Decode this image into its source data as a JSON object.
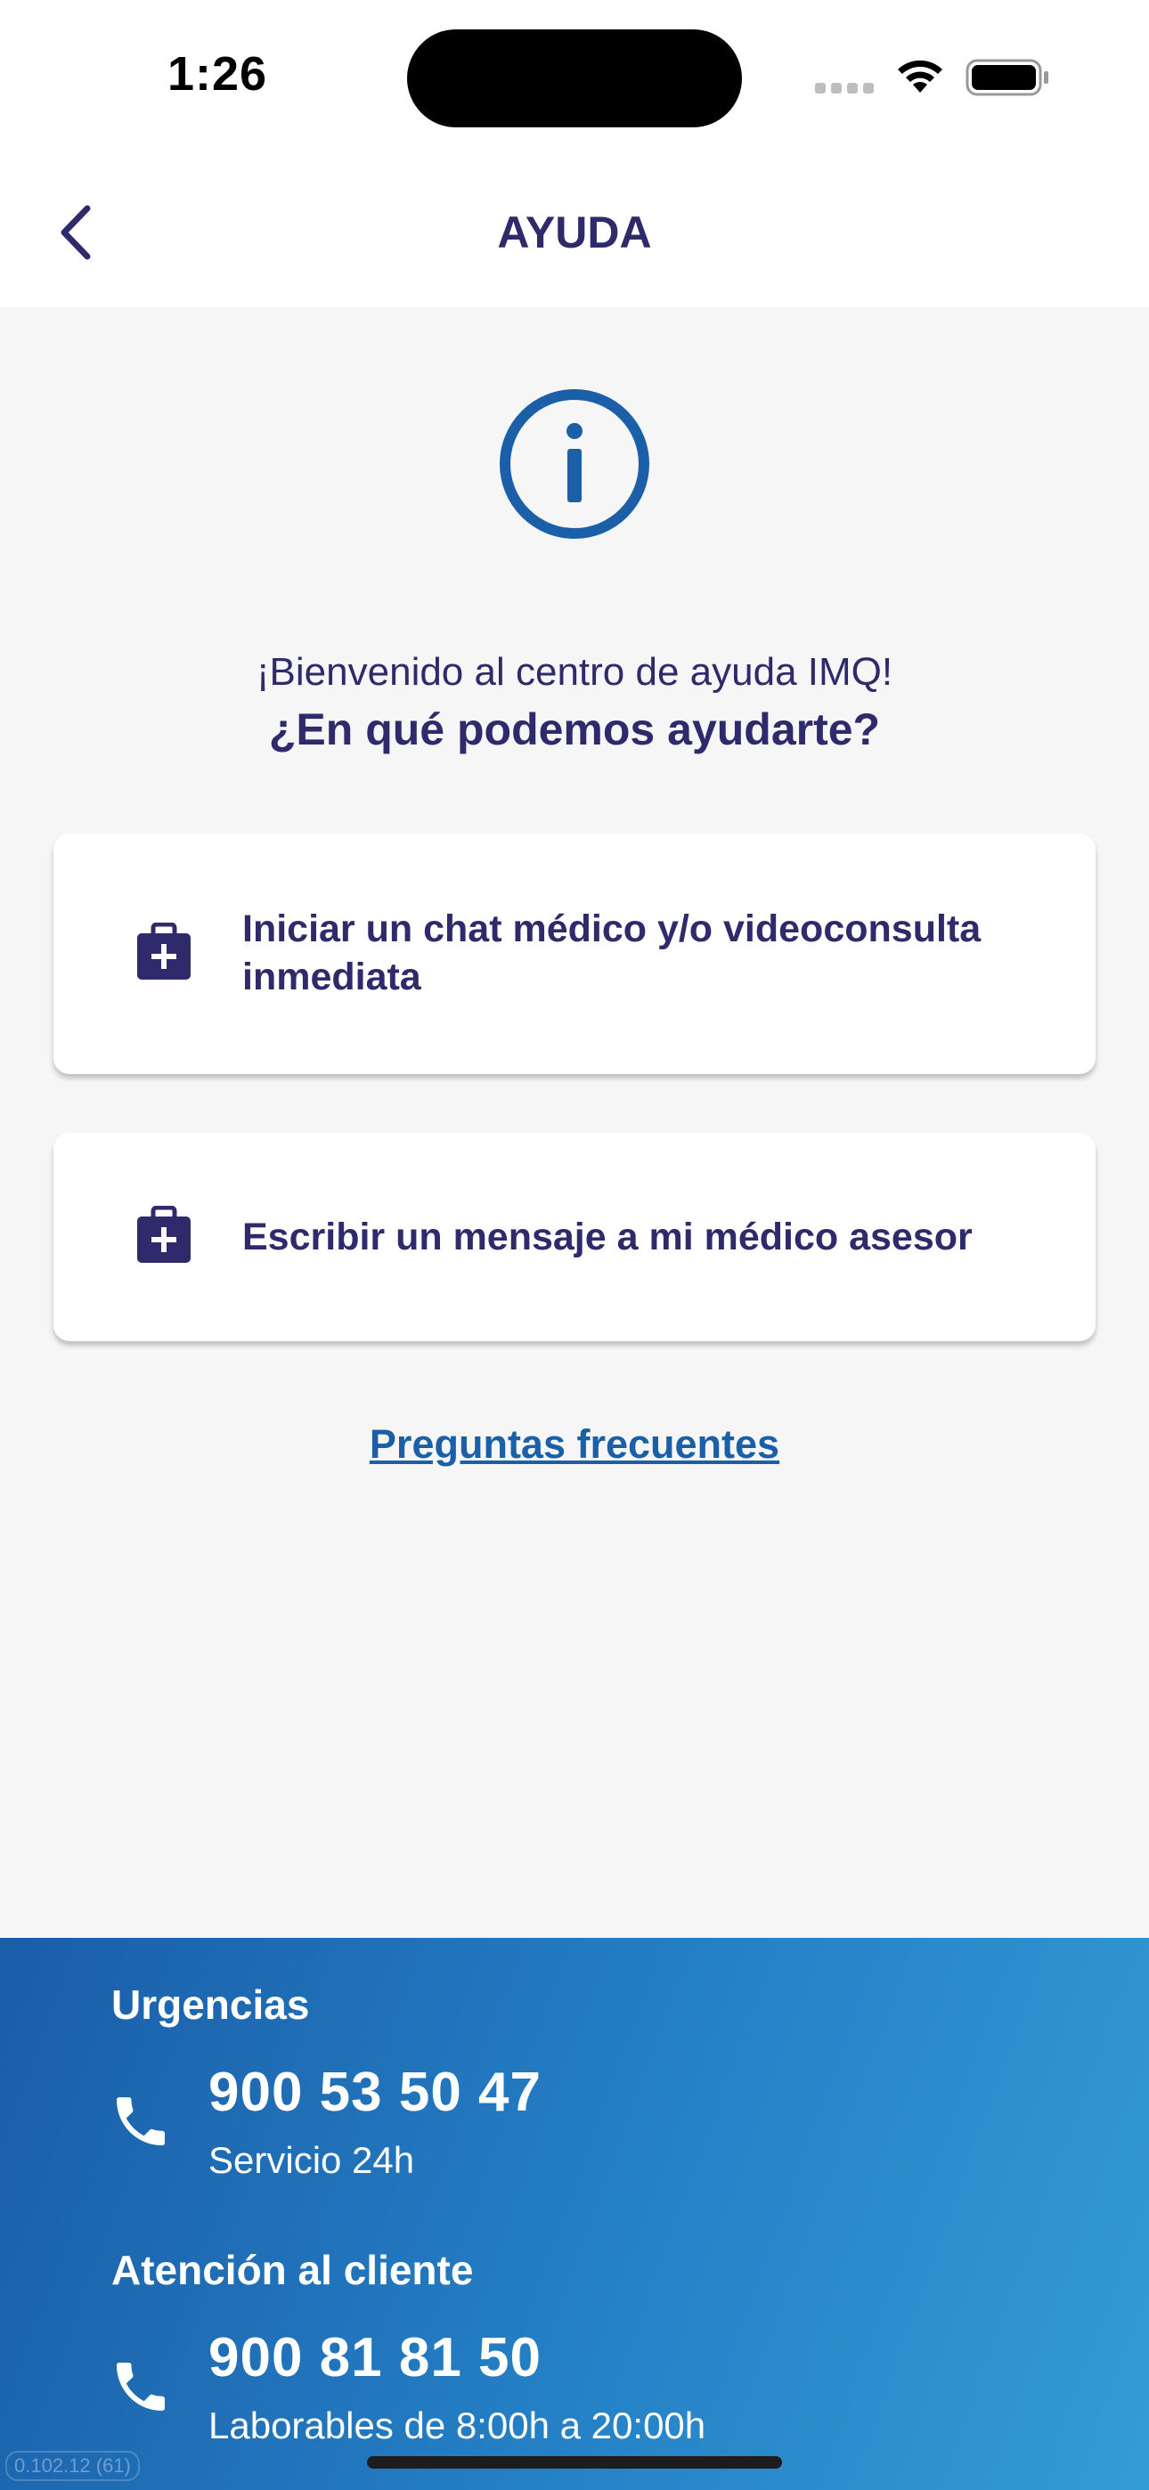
{
  "status_bar": {
    "time": "1:26",
    "icons": [
      "signal-dots-icon",
      "wifi-icon",
      "battery-icon"
    ]
  },
  "header": {
    "title": "AYUDA",
    "back_icon": "chevron-left-icon"
  },
  "intro": {
    "icon": "info-circle-icon",
    "welcome": "¡Bienvenido al centro de ayuda IMQ!",
    "question": "¿En qué podemos ayudarte?"
  },
  "options": [
    {
      "icon": "medical-briefcase-icon",
      "label": "Iniciar un chat médico y/o videoconsulta inmediata"
    },
    {
      "icon": "medical-briefcase-icon",
      "label": "Escribir un mensaje a mi médico asesor"
    }
  ],
  "faq_link": "Preguntas frecuentes",
  "contacts": [
    {
      "label": "Urgencias",
      "icon": "phone-icon",
      "number": "900 53 50 47",
      "hours": "Servicio 24h"
    },
    {
      "label": "Atención al cliente",
      "icon": "phone-icon",
      "number": "900 81 81 50",
      "hours": "Laborables de 8:00h a 20:00h"
    }
  ],
  "version": "0.102.12 (61)",
  "colors": {
    "primary_text": "#2f2a6b",
    "link": "#1a5fa8",
    "info_icon": "#1a5fa8",
    "footer_gradient_start": "#1a5da8",
    "footer_gradient_end": "#349cd6",
    "background": "#f6f6f6"
  }
}
